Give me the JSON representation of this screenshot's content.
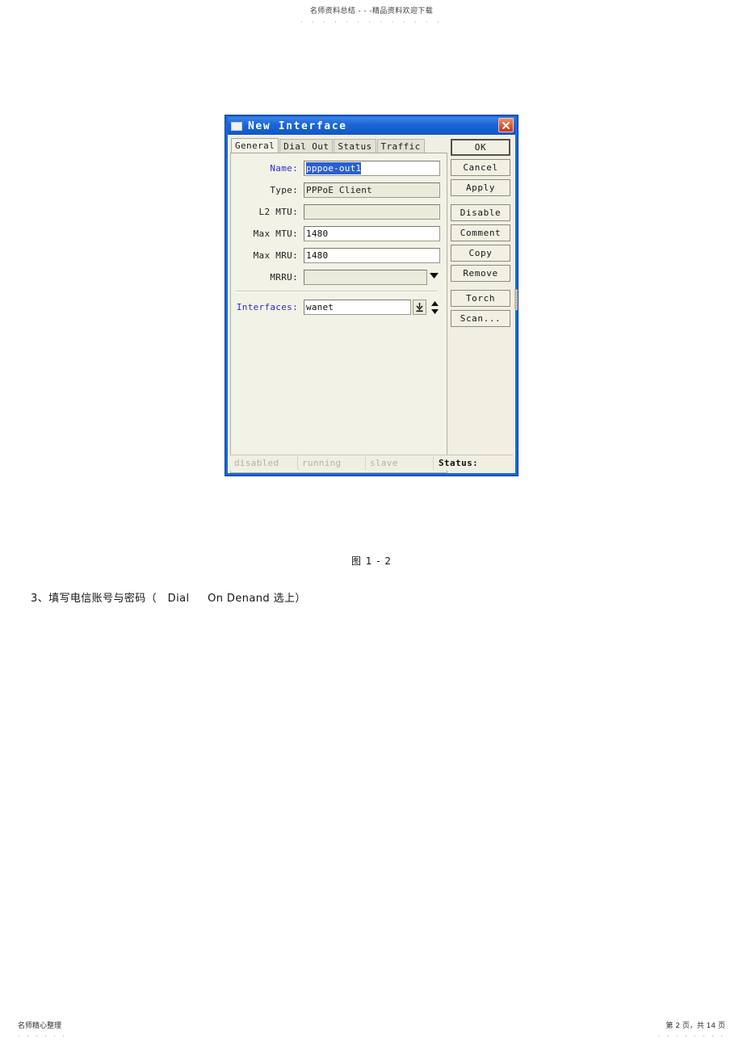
{
  "page": {
    "watermark_header": "名师资料总结 - - -精品资料欢迎下载",
    "watermark_dots": "· · · · · · · · · · · · ·",
    "figure_caption": "图 1 - 2",
    "body_text": "3、填写电信账号与密码（   Dial     On Denand 选上）",
    "footer_left": "名师精心整理",
    "footer_left_dots": "· · · · · ·",
    "footer_right": "第 2 页，共 14 页",
    "footer_right_dots": "· · · · · · · ·"
  },
  "dialog": {
    "title": "New Interface",
    "icon": "window-icon",
    "close_icon": "close-icon",
    "colors": {
      "titlebar": "#1a66d6",
      "body": "#f0efe2",
      "panel": "#f3f2e6",
      "close_button": "#d4482a",
      "selection": "#2b5fd0",
      "label_accent": "#2a2ad0"
    },
    "tabs": [
      {
        "label": "General",
        "active": true
      },
      {
        "label": "Dial Out",
        "active": false
      },
      {
        "label": "Status",
        "active": false
      },
      {
        "label": "Traffic",
        "active": false
      }
    ],
    "fields": [
      {
        "label": "Name:",
        "value": "pppoe-out1",
        "selected": true,
        "disabled": false,
        "accent": true
      },
      {
        "label": "Type:",
        "value": "PPPoE Client",
        "selected": false,
        "disabled": true,
        "accent": false
      },
      {
        "label": "L2 MTU:",
        "value": "",
        "selected": false,
        "disabled": true,
        "accent": false
      },
      {
        "label": "Max MTU:",
        "value": "1480",
        "selected": false,
        "disabled": false,
        "accent": false
      },
      {
        "label": "Max MRU:",
        "value": "1480",
        "selected": false,
        "disabled": false,
        "accent": false
      },
      {
        "label": "MRRU:",
        "value": "",
        "selected": false,
        "disabled": true,
        "accent": false,
        "dropdown": true
      }
    ],
    "interfaces_field": {
      "label": "Interfaces:",
      "value": "wanet",
      "picker_icon": "down-arrow-to-bar-icon",
      "spinner_icon": "up-down-spinner-icon"
    },
    "buttons": [
      {
        "label": "OK",
        "primary": true,
        "gap": false
      },
      {
        "label": "Cancel",
        "primary": false,
        "gap": false
      },
      {
        "label": "Apply",
        "primary": false,
        "gap": false
      },
      {
        "label": "Disable",
        "primary": false,
        "gap": true
      },
      {
        "label": "Comment",
        "primary": false,
        "gap": false
      },
      {
        "label": "Copy",
        "primary": false,
        "gap": false
      },
      {
        "label": "Remove",
        "primary": false,
        "gap": false
      },
      {
        "label": "Torch",
        "primary": false,
        "gap": true
      },
      {
        "label": "Scan...",
        "primary": false,
        "gap": false
      }
    ],
    "statusbar": {
      "flags": [
        "disabled",
        "running",
        "slave"
      ],
      "status_label": "Status:",
      "status_value": ""
    }
  }
}
